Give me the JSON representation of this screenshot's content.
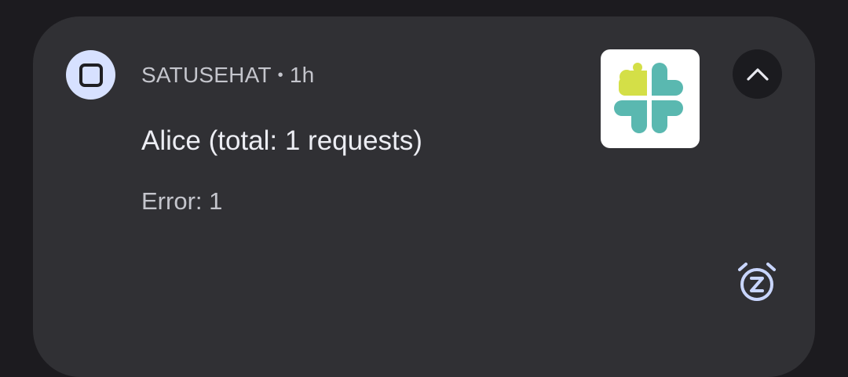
{
  "notification": {
    "app_name": "SATUSEHAT",
    "separator": "•",
    "time": "1h",
    "title": "Alice (total: 1 requests)",
    "body": "Error: 1",
    "app_icon": "app-square-icon",
    "large_icon": "satusehat-logo",
    "expand_icon": "chevron-up-icon",
    "snooze_icon": "snooze-alarm-icon"
  },
  "colors": {
    "background": "#1c1b1f",
    "card": "#303034",
    "app_icon_bg": "#d7e1ff",
    "logo_lime": "#d4df47",
    "logo_teal": "#5ab8b0"
  }
}
